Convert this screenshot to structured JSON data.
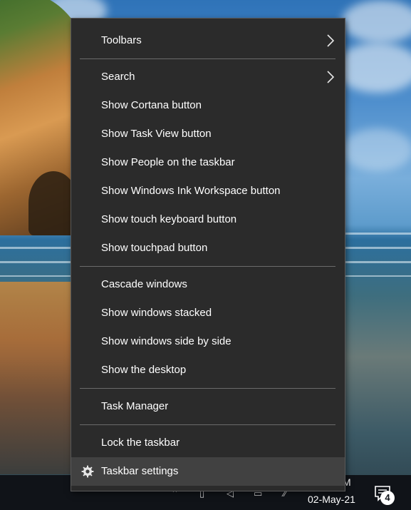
{
  "menu": {
    "toolbars": "Toolbars",
    "search": "Search",
    "show_cortana": "Show Cortana button",
    "show_task_view": "Show Task View button",
    "show_people": "Show People on the taskbar",
    "show_ink": "Show Windows Ink Workspace button",
    "show_touch_keyboard": "Show touch keyboard button",
    "show_touchpad": "Show touchpad button",
    "cascade": "Cascade windows",
    "stacked": "Show windows stacked",
    "side_by_side": "Show windows side by side",
    "show_desktop": "Show the desktop",
    "task_manager": "Task Manager",
    "lock_taskbar": "Lock the taskbar",
    "taskbar_settings": "Taskbar settings",
    "settings_icon": "gear-icon",
    "submenu_icon": "chevron-right-icon"
  },
  "taskbar": {
    "time_partial": "M",
    "date": "02-May-21",
    "notification_count": "4"
  }
}
